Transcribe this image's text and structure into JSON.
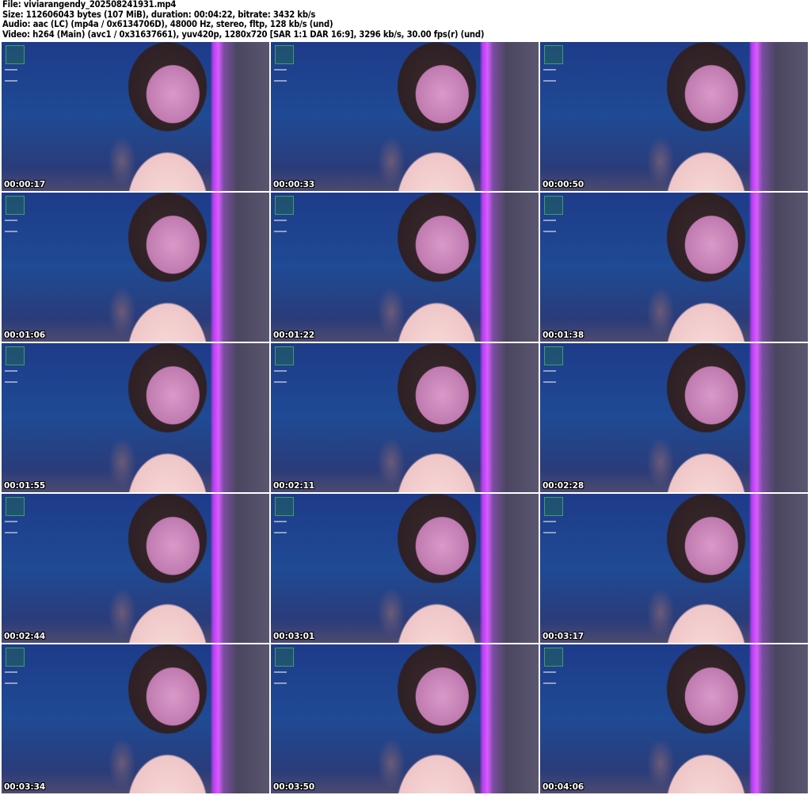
{
  "header": {
    "file": "File: viviarangendy_202508241931.mp4",
    "size": "Size: 112606043 bytes (107 MiB), duration: 00:04:22, bitrate: 3432 kb/s",
    "audio": "Audio: aac (LC) (mp4a / 0x6134706D), 48000 Hz, stereo, fltp, 128 kb/s (und)",
    "video": "Video: h264 (Main) (avc1 / 0x31637661), yuv420p, 1280x720 [SAR 1:1 DAR 16:9], 3296 kb/s, 30.00 fps(r) (und)"
  },
  "thumbnails": [
    {
      "timestamp": "00:00:17"
    },
    {
      "timestamp": "00:00:33"
    },
    {
      "timestamp": "00:00:50"
    },
    {
      "timestamp": "00:01:06"
    },
    {
      "timestamp": "00:01:22"
    },
    {
      "timestamp": "00:01:38"
    },
    {
      "timestamp": "00:01:55"
    },
    {
      "timestamp": "00:02:11"
    },
    {
      "timestamp": "00:02:28"
    },
    {
      "timestamp": "00:02:44"
    },
    {
      "timestamp": "00:03:01"
    },
    {
      "timestamp": "00:03:17"
    },
    {
      "timestamp": "00:03:34"
    },
    {
      "timestamp": "00:03:50"
    },
    {
      "timestamp": "00:04:06"
    }
  ]
}
